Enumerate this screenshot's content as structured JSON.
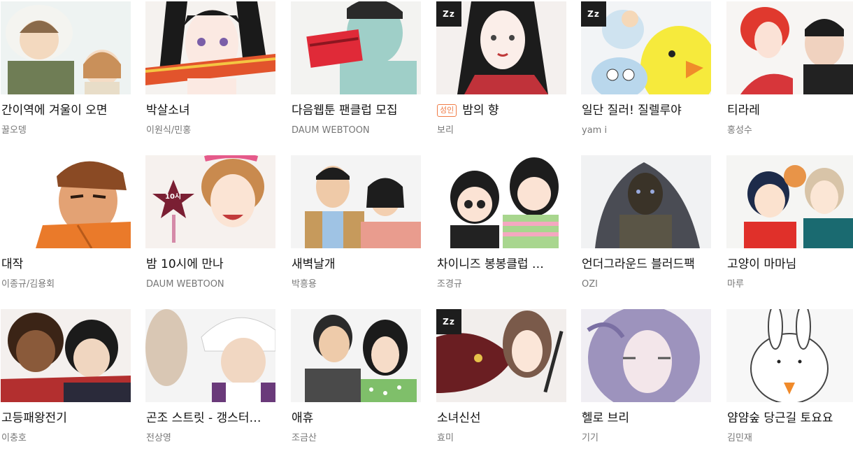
{
  "colors": {
    "title": "#111111",
    "author": "#777777",
    "adult_badge": "#f07b45",
    "zz_badge": "#1d1d1d"
  },
  "webtoons": [
    {
      "title": "간이역에 겨울이 오면",
      "author": "꿀오뎅",
      "zz": false,
      "adult": false
    },
    {
      "title": "박살소녀",
      "author": "이원식/민홍",
      "zz": false,
      "adult": false
    },
    {
      "title": "다음웹툰 팬클럽 모집",
      "author": "DAUM WEBTOON",
      "zz": false,
      "adult": false
    },
    {
      "title": "밤의 향",
      "author": "보리",
      "zz": true,
      "zz_label": "Zz",
      "adult": true,
      "adult_label": "성인"
    },
    {
      "title": "일단 질러! 질렐루야",
      "author": "yam i",
      "zz": true,
      "zz_label": "Zz",
      "adult": false
    },
    {
      "title": "티라레",
      "author": "홍성수",
      "zz": false,
      "adult": false
    },
    {
      "title": "대작",
      "author": "이종규/김용회",
      "zz": false,
      "adult": false
    },
    {
      "title": "밤 10시에 만나",
      "author": "DAUM WEBTOON",
      "zz": false,
      "adult": false,
      "thumb_text": "10시"
    },
    {
      "title": "새벽날개",
      "author": "박흥용",
      "zz": false,
      "adult": false
    },
    {
      "title": "차이니즈 봉봉클럽 …",
      "author": "조경규",
      "zz": false,
      "adult": false
    },
    {
      "title": "언더그라운드 블러드팩",
      "author": "OZI",
      "zz": false,
      "adult": false
    },
    {
      "title": "고양이 마마님",
      "author": "마루",
      "zz": false,
      "adult": false
    },
    {
      "title": "고등패왕전기",
      "author": "이충호",
      "zz": false,
      "adult": false
    },
    {
      "title": "곤조 스트릿 - 갱스터…",
      "author": "전상영",
      "zz": false,
      "adult": false
    },
    {
      "title": "애휴",
      "author": "조금산",
      "zz": false,
      "adult": false
    },
    {
      "title": "소녀신선",
      "author": "효미",
      "zz": true,
      "zz_label": "Zz",
      "adult": false
    },
    {
      "title": "헬로 브리",
      "author": "기기",
      "zz": false,
      "adult": false
    },
    {
      "title": "얌얌숲 당근길 토요요",
      "author": "김민재",
      "zz": false,
      "adult": false
    }
  ]
}
